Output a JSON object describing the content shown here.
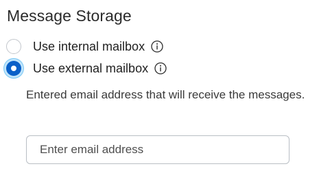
{
  "section": {
    "title": "Message Storage"
  },
  "storage_options": [
    {
      "label": "Use internal mailbox",
      "selected": false,
      "info_icon": "info-icon"
    },
    {
      "label": "Use external mailbox",
      "selected": true,
      "info_icon": "info-icon"
    }
  ],
  "external": {
    "helper_text": "Entered email address that will receive the messages.",
    "email_value": "",
    "email_placeholder": "Enter email address"
  },
  "colors": {
    "accent": "#0a60c8",
    "focus_ring": "#7cc8f4",
    "border": "#b9bec4"
  }
}
